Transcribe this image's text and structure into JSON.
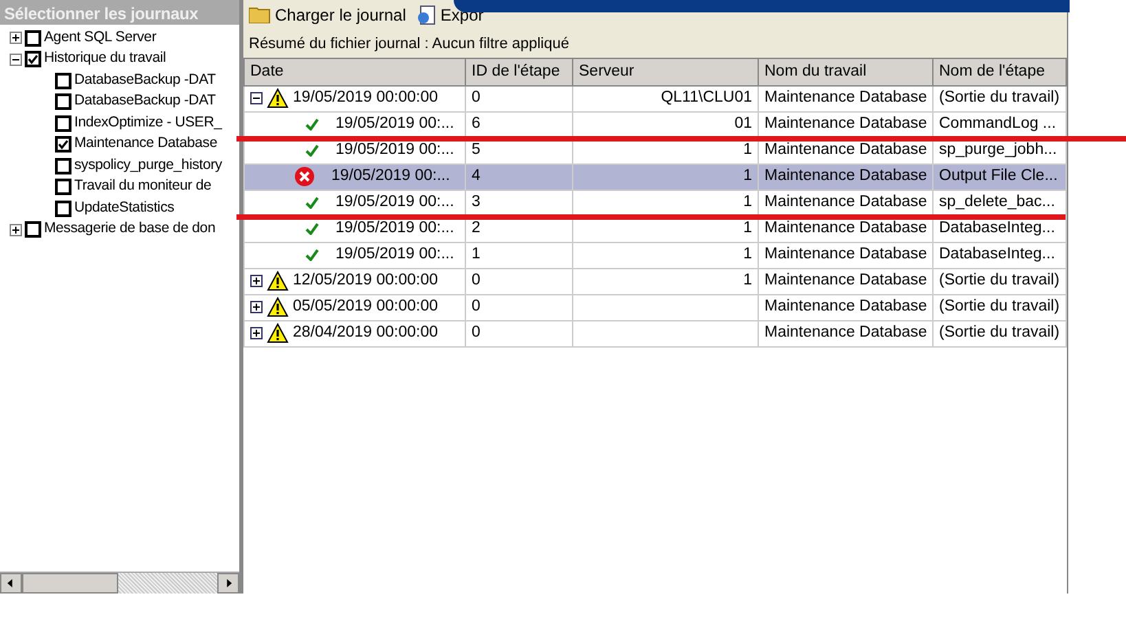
{
  "sidebar": {
    "title": "Sélectionner les journaux",
    "items": [
      {
        "label": "Agent SQL Server",
        "checked": false,
        "expanded": false
      },
      {
        "label": "Historique du travail",
        "checked": true,
        "expanded": true,
        "children": [
          {
            "label": "DatabaseBackup -DAT",
            "checked": false
          },
          {
            "label": "DatabaseBackup -DAT",
            "checked": false
          },
          {
            "label": "IndexOptimize - USER_",
            "checked": false
          },
          {
            "label": "Maintenance Database",
            "checked": true
          },
          {
            "label": "syspolicy_purge_history",
            "checked": false
          },
          {
            "label": "Travail du moniteur de",
            "checked": false
          },
          {
            "label": "UpdateStatistics",
            "checked": false
          }
        ]
      },
      {
        "label": "Messagerie de base de don",
        "checked": false,
        "expanded": false
      }
    ]
  },
  "toolbar": {
    "buttons": [
      "Charger le journal",
      "Expor"
    ]
  },
  "summary": "Résumé du fichier journal : Aucun filtre appliqué",
  "table": {
    "columns": [
      "Date",
      "ID de l'étape",
      "Serveur",
      "Nom du travail",
      "Nom de l'étape"
    ],
    "rows": [
      {
        "kind": "warning",
        "expanded": true,
        "selected": false,
        "date": "19/05/2019 00:00:00",
        "step_id": "0",
        "server": "QL11\\CLU01",
        "job": "Maintenance Database",
        "step": "(Sortie du travail)"
      },
      {
        "kind": "success",
        "selected": false,
        "date": "19/05/2019 00:...",
        "step_id": "6",
        "server": "01",
        "job": "Maintenance Database",
        "step": "CommandLog ..."
      },
      {
        "kind": "success",
        "selected": false,
        "date": "19/05/2019 00:...",
        "step_id": "5",
        "server": "1",
        "job": "Maintenance Database",
        "step": "sp_purge_jobh..."
      },
      {
        "kind": "error",
        "selected": true,
        "date": "19/05/2019 00:...",
        "step_id": "4",
        "server": "1",
        "job": "Maintenance Database",
        "step": "Output File Cle..."
      },
      {
        "kind": "success",
        "selected": false,
        "date": "19/05/2019 00:...",
        "step_id": "3",
        "server": "1",
        "job": "Maintenance Database",
        "step": "sp_delete_bac..."
      },
      {
        "kind": "success",
        "selected": false,
        "date": "19/05/2019 00:...",
        "step_id": "2",
        "server": "1",
        "job": "Maintenance Database",
        "step": "DatabaseInteg..."
      },
      {
        "kind": "success",
        "selected": false,
        "date": "19/05/2019 00:...",
        "step_id": "1",
        "server": "1",
        "job": "Maintenance Database",
        "step": "DatabaseInteg..."
      },
      {
        "kind": "warning",
        "expanded": false,
        "selected": false,
        "date": "12/05/2019 00:00:00",
        "step_id": "0",
        "server": "1",
        "job": "Maintenance Database",
        "step": "(Sortie du travail)"
      },
      {
        "kind": "warning",
        "expanded": false,
        "selected": false,
        "date": "05/05/2019 00:00:00",
        "step_id": "0",
        "job": "Maintenance Database",
        "step": "(Sortie du travail)"
      },
      {
        "kind": "warning",
        "expanded": false,
        "selected": false,
        "date": "28/04/2019 00:00:00",
        "step_id": "0",
        "job": "Maintenance Database",
        "step": "(Sortie du travail)"
      }
    ]
  }
}
